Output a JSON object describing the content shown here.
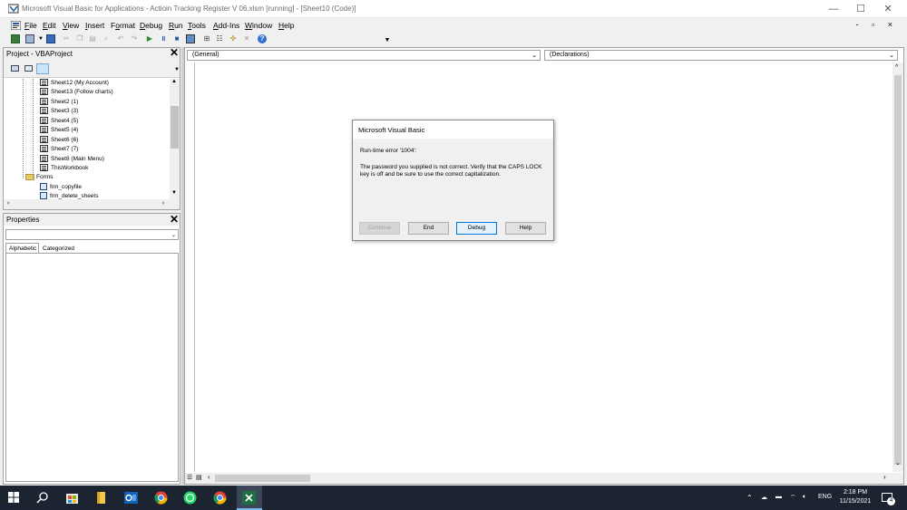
{
  "window": {
    "title": "Microsoft Visual Basic for Applications - Actioin Tracking Register V 06.xlsm [running] - [Sheet10 (Code)]",
    "controls": {
      "minimize": "—",
      "maximize": "☐",
      "close": "✕"
    }
  },
  "menubar": {
    "items": [
      {
        "label": "File",
        "mnemonic": "F"
      },
      {
        "label": "Edit",
        "mnemonic": "E"
      },
      {
        "label": "View",
        "mnemonic": "V"
      },
      {
        "label": "Insert",
        "mnemonic": "I"
      },
      {
        "label": "Format",
        "mnemonic": "o"
      },
      {
        "label": "Debug",
        "mnemonic": "D"
      },
      {
        "label": "Run",
        "mnemonic": "R"
      },
      {
        "label": "Tools",
        "mnemonic": "T"
      },
      {
        "label": "Add-Ins",
        "mnemonic": "A"
      },
      {
        "label": "Window",
        "mnemonic": "W"
      },
      {
        "label": "Help",
        "mnemonic": "H"
      }
    ],
    "mdi_controls": "- ▫ ×"
  },
  "project_pane": {
    "title": "Project - VBAProject",
    "tree": [
      {
        "label": "Sheet12 (My Account)",
        "kind": "module"
      },
      {
        "label": "Sheet13 (Follow charts)",
        "kind": "module"
      },
      {
        "label": "Sheet2 (1)",
        "kind": "module"
      },
      {
        "label": "Sheet3 (3)",
        "kind": "module"
      },
      {
        "label": "Sheet4 (5)",
        "kind": "module"
      },
      {
        "label": "Sheet5 (4)",
        "kind": "module"
      },
      {
        "label": "Sheet6 (6)",
        "kind": "module"
      },
      {
        "label": "Sheet7 (7)",
        "kind": "module"
      },
      {
        "label": "Sheet8 (Main Menu)",
        "kind": "module"
      },
      {
        "label": "ThisWorkbook",
        "kind": "module"
      },
      {
        "label": "Forms",
        "kind": "folder"
      },
      {
        "label": "frm_copyfile",
        "kind": "form"
      },
      {
        "label": "frm_delete_sheets",
        "kind": "form"
      }
    ]
  },
  "properties_pane": {
    "title": "Properties",
    "tabs": [
      "Alphabetic",
      "Categorized"
    ]
  },
  "code_window": {
    "object_combo": "(General)",
    "procedure_combo": "(Declarations)"
  },
  "dialog": {
    "title": "Microsoft Visual Basic",
    "error_line": "Run-time error '1004':",
    "message_line1": "The password you supplied is not correct. Verify that the CAPS LOCK",
    "message_line2": "key is off and be sure to use the correct capitalization.",
    "buttons": {
      "continue": "Continue",
      "end": "End",
      "debug": "Debug",
      "help": "Help"
    }
  },
  "taskbar": {
    "language": "ENG",
    "time": "2:18 PM",
    "date": "11/15/2021",
    "notification_count": "4"
  },
  "colors": {
    "taskbar_bg": "#1b2430",
    "dialog_default_border": "#0078d7"
  }
}
